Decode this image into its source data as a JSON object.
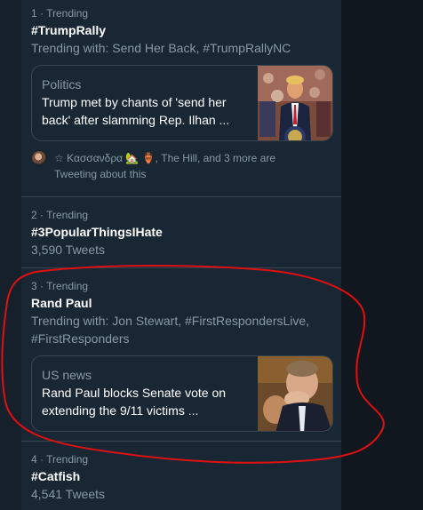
{
  "trends": [
    {
      "meta": "1 · Trending",
      "title": "#TrumpRally",
      "sub": "Trending with: Send Her Back, #TrumpRallyNC",
      "card": {
        "category": "Politics",
        "headline_line1": "Trump met by chants of 'send her",
        "headline_line2": "back' after slamming Rep. Ilhan ..."
      },
      "social": {
        "line1": "☆ Κασσανδρα 🏡 🏺, The Hill, and 3 more are",
        "line2": "Tweeting about this"
      }
    },
    {
      "meta": "2 · Trending",
      "title": "#3PopularThingsIHate",
      "sub": "3,590 Tweets"
    },
    {
      "meta": "3 · Trending",
      "title": "Rand Paul",
      "sub_line1": "Trending with: Jon Stewart, #FirstRespondersLive,",
      "sub_line2": "#FirstResponders",
      "card": {
        "category": "US news",
        "headline_line1": "Rand Paul blocks Senate vote on",
        "headline_line2": "extending the 9/11 victims ..."
      }
    },
    {
      "meta": "4 · Trending",
      "title": "#Catfish",
      "sub": "4,541 Tweets"
    }
  ],
  "colors": {
    "background": "#15202b",
    "panel": "#192734",
    "secondary_text": "#8899a6",
    "annotation": "#e01010"
  }
}
